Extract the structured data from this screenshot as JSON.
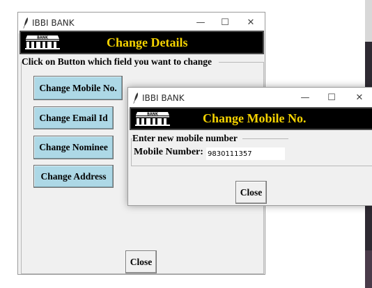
{
  "window_main": {
    "title": "IBBI BANK",
    "controls": {
      "minimize": "—",
      "maximize": "☐",
      "close": "✕"
    },
    "logo_text": "BANK",
    "heading": "Change Details",
    "group_label": "Click on Button which field you want to change",
    "buttons": [
      {
        "label": "Change Mobile No."
      },
      {
        "label": "Change Email Id"
      },
      {
        "label": "Change Nominee"
      },
      {
        "label": "Change Address"
      }
    ],
    "close_label": "Close"
  },
  "window_popup": {
    "title": "IBBI BANK",
    "controls": {
      "minimize": "—",
      "maximize": "☐",
      "close": "✕"
    },
    "logo_text": "BANK",
    "heading": "Change Mobile No.",
    "group_label": "Enter new mobile number",
    "field_label": "Mobile Number:",
    "field_value": "9830111357",
    "close_label": "Close"
  },
  "colors": {
    "banner_bg": "#000000",
    "heading_text": "#f5d300",
    "button_bg": "#add8e6",
    "window_bg": "#f0f0f0"
  }
}
